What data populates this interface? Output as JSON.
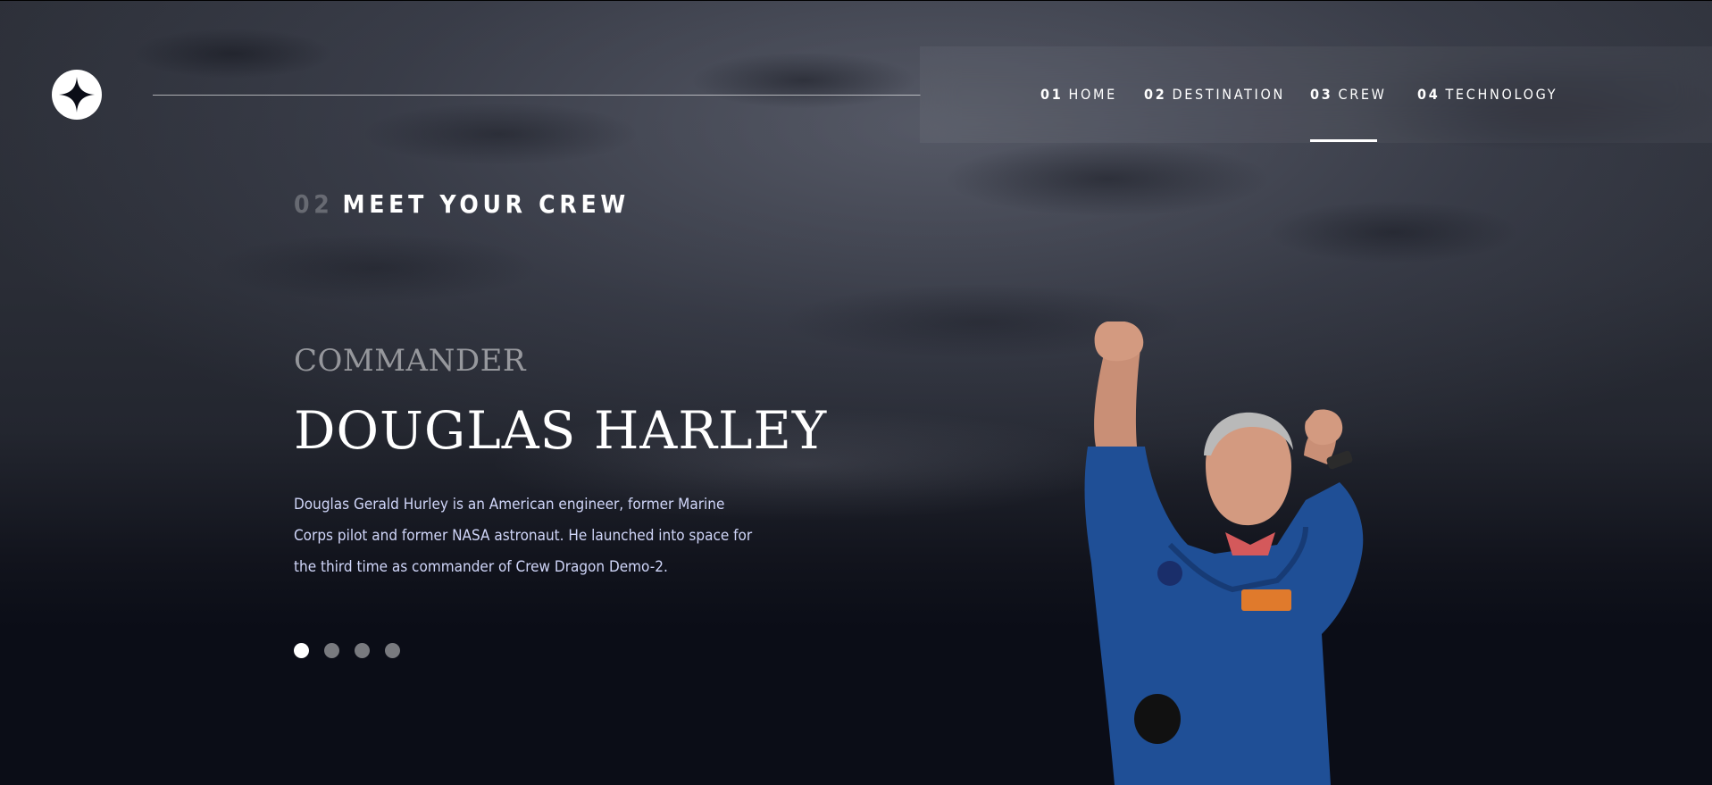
{
  "nav": {
    "items": [
      {
        "num": "01",
        "label": "HOME"
      },
      {
        "num": "02",
        "label": "DESTINATION"
      },
      {
        "num": "03",
        "label": "CREW"
      },
      {
        "num": "04",
        "label": "TECHNOLOGY"
      }
    ],
    "active_index": 2
  },
  "heading": {
    "num": "02",
    "title": "MEET YOUR CREW"
  },
  "crew": {
    "role": "COMMANDER",
    "name": "DOUGLAS HARLEY",
    "bio": "Douglas Gerald Hurley is an American engineer, former Marine Corps pilot and former NASA astronaut. He launched into space for the third time as commander of Crew Dragon Demo-2."
  },
  "slider": {
    "count": 4,
    "active_index": 0
  },
  "icons": {
    "logo": "star-logo-icon"
  },
  "colors": {
    "background": "#0b0d17",
    "accent_text": "#d0d6f9",
    "white": "#ffffff"
  }
}
